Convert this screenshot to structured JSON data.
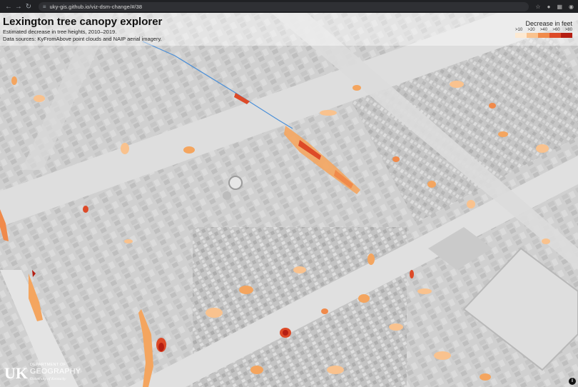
{
  "browser": {
    "url": "uky-gis.github.io/viz-dsm-change/#/38"
  },
  "header": {
    "title": "Lexington tree canopy explorer",
    "subtitle": "Estimated decrease in tree heights, 2010–2019.",
    "sources": "Data sources: KyFromAbove point clouds and NAIP aerial imagery."
  },
  "legend": {
    "title": "Decrease in feet",
    "classes": [
      {
        "label": ">10",
        "color": "#fde9d2"
      },
      {
        "label": ">20",
        "color": "#f9c28e"
      },
      {
        "label": ">40",
        "color": "#f08a4b"
      },
      {
        "label": ">60",
        "color": "#dd4a28"
      },
      {
        "label": ">80",
        "color": "#b51e12"
      }
    ]
  },
  "logo": {
    "mark": "UK",
    "department": "DEPARTMENT OF",
    "name": "GEOGRAPHY",
    "university": "University of Kentucky"
  },
  "map": {
    "basemap": "grayscale hillshade surface model",
    "route_color": "#4a8fd8"
  },
  "info_button": {
    "label": "i"
  }
}
